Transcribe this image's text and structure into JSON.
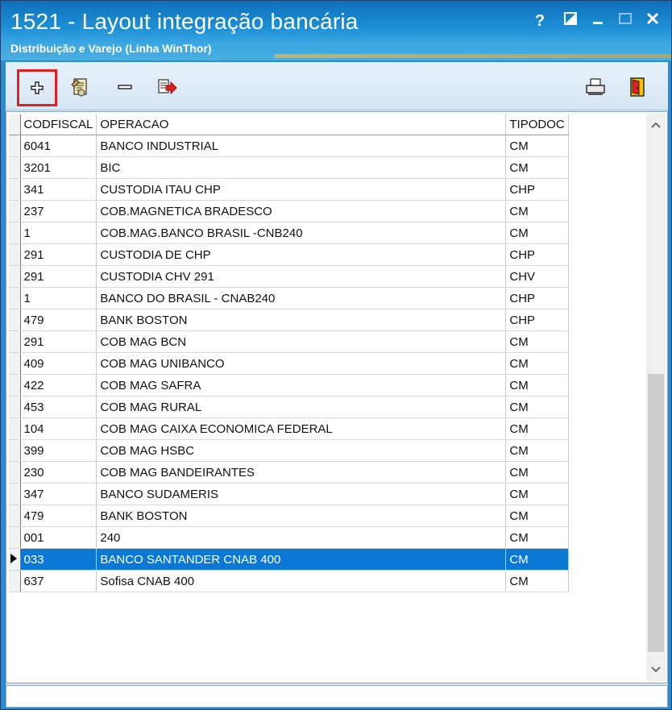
{
  "window": {
    "title": "1521 - Layout integração bancária",
    "subtitle": "Distribuição e Varejo (Linha WinThor)",
    "controls": {
      "help": "?",
      "restore": "◪",
      "minimize": "‒",
      "maximize": "☐",
      "close": "✕"
    }
  },
  "toolbar": {
    "buttons": [
      {
        "name": "add-button",
        "icon": "plus-icon"
      },
      {
        "name": "edit-button",
        "icon": "edit-document-icon"
      },
      {
        "name": "remove-button",
        "icon": "minus-icon"
      },
      {
        "name": "export-button",
        "icon": "export-arrow-icon"
      },
      {
        "name": "print-button",
        "icon": "printer-icon"
      },
      {
        "name": "exit-button",
        "icon": "exit-door-icon"
      }
    ],
    "highlight_color": "#e02020"
  },
  "grid": {
    "columns": [
      "CODFISCAL",
      "OPERACAO",
      "TIPODOC"
    ],
    "rows": [
      [
        "6041",
        "BANCO INDUSTRIAL",
        "CM"
      ],
      [
        "3201",
        "BIC",
        "CM"
      ],
      [
        "341",
        "CUSTODIA ITAU CHP",
        "CHP"
      ],
      [
        "237",
        "COB.MAGNETICA BRADESCO",
        "CM"
      ],
      [
        "1",
        "COB.MAG.BANCO BRASIL -CNB240",
        "CM"
      ],
      [
        "291",
        "CUSTODIA DE CHP",
        "CHP"
      ],
      [
        "291",
        "CUSTODIA CHV 291",
        "CHV"
      ],
      [
        "1",
        "BANCO DO BRASIL - CNAB240",
        "CHP"
      ],
      [
        "479",
        "BANK BOSTON",
        "CHP"
      ],
      [
        "291",
        "COB MAG BCN",
        "CM"
      ],
      [
        "409",
        "COB MAG UNIBANCO",
        "CM"
      ],
      [
        "422",
        "COB MAG SAFRA",
        "CM"
      ],
      [
        "453",
        "COB MAG RURAL",
        "CM"
      ],
      [
        "104",
        "COB MAG CAIXA ECONOMICA FEDERAL",
        "CM"
      ],
      [
        "399",
        "COB MAG HSBC",
        "CM"
      ],
      [
        "230",
        "COB MAG BANDEIRANTES",
        "CM"
      ],
      [
        "347",
        "BANCO SUDAMERIS",
        "CM"
      ],
      [
        "479",
        "BANK BOSTON",
        "CM"
      ],
      [
        "001",
        "240",
        "CM"
      ],
      [
        "033",
        "BANCO SANTANDER CNAB 400",
        "CM"
      ],
      [
        "637",
        "Sofisa CNAB 400",
        "CM"
      ]
    ],
    "selected_row": 19,
    "selection_color": "#0a78d4"
  },
  "scrollbar": {
    "up": "˄",
    "down": "˅"
  }
}
